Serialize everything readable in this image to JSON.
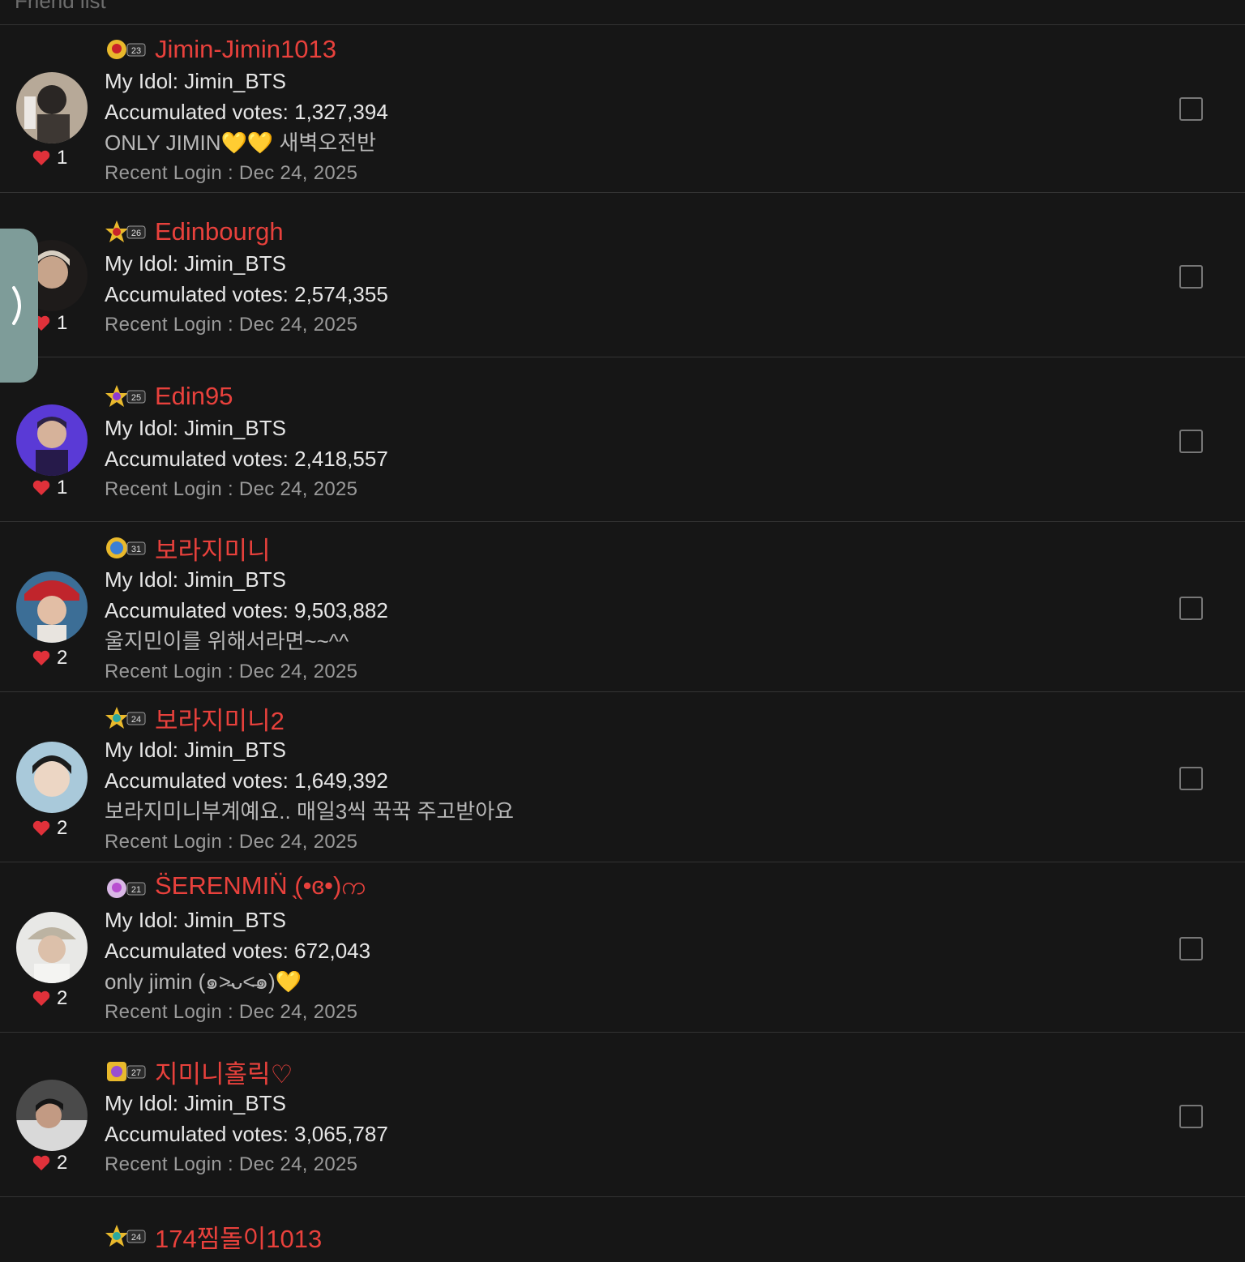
{
  "header": {
    "title": "Friend list"
  },
  "side_tab": {
    "icon": "chevron-right-icon"
  },
  "rows": [
    {
      "badge_level": "23",
      "name": "Jimin-Jimin1013",
      "idol": "My Idol: Jimin_BTS",
      "votes": "Accumulated votes: 1,327,394",
      "message": "ONLY JIMIN💛💛 새벽오전반",
      "login": "Recent Login : Dec 24, 2025",
      "likes": "1"
    },
    {
      "badge_level": "26",
      "name": "Edinbourgh",
      "idol": "My Idol: Jimin_BTS",
      "votes": "Accumulated votes: 2,574,355",
      "message": "",
      "login": "Recent Login : Dec 24, 2025",
      "likes": "1"
    },
    {
      "badge_level": "25",
      "name": "Edin95",
      "idol": "My Idol: Jimin_BTS",
      "votes": "Accumulated votes: 2,418,557",
      "message": "",
      "login": "Recent Login : Dec 24, 2025",
      "likes": "1"
    },
    {
      "badge_level": "31",
      "name": "보라지미니",
      "idol": "My Idol: Jimin_BTS",
      "votes": "Accumulated votes: 9,503,882",
      "message": "울지민이를 위해서라면~~^^",
      "login": "Recent Login : Dec 24, 2025",
      "likes": "2"
    },
    {
      "badge_level": "24",
      "name": "보라지미니2",
      "idol": "My Idol: Jimin_BTS",
      "votes": "Accumulated votes: 1,649,392",
      "message": "보라지미니부계예요..  매일3씩 꾹꾹 주고받아요",
      "login": "Recent Login : Dec 24, 2025",
      "likes": "2"
    },
    {
      "badge_level": "21",
      "name": "S̈ERENMIN̈ ̖(•ɞ•)က",
      "idol": "My Idol: Jimin_BTS",
      "votes": "Accumulated votes: 672,043",
      "message": "only jimin (๑˃̵ᴗ˂̵๑)💛",
      "login": "Recent Login : Dec 24, 2025",
      "likes": "2"
    },
    {
      "badge_level": "27",
      "name": "지미니홀릭♡",
      "idol": "My Idol: Jimin_BTS",
      "votes": "Accumulated votes: 3,065,787",
      "message": "",
      "login": "Recent Login : Dec 24, 2025",
      "likes": "2"
    },
    {
      "badge_level": "24",
      "name": "174찜돌이1013",
      "idol": "",
      "votes": "",
      "message": "",
      "login": "",
      "likes": ""
    }
  ],
  "colors": {
    "name": "#e8413c",
    "background": "#161616",
    "heart": "#e0313a",
    "side_tab": "#7e9c99"
  }
}
